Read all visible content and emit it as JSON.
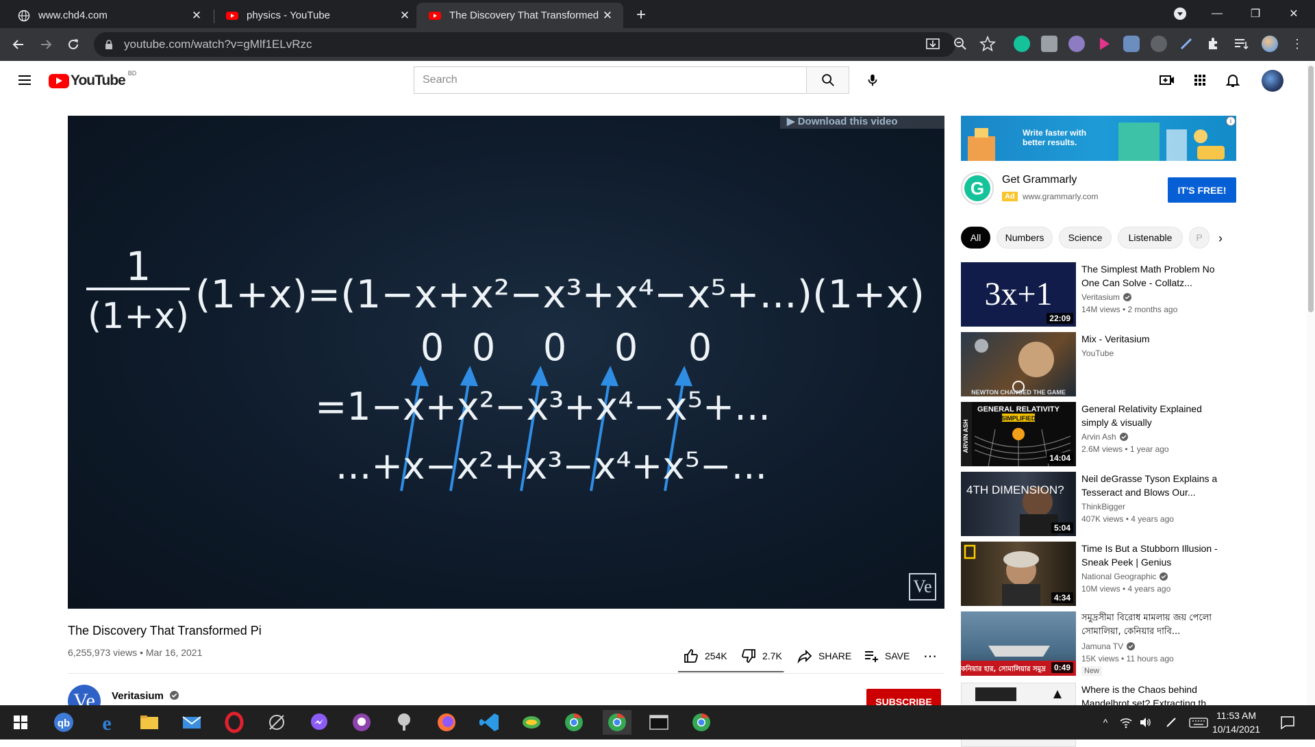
{
  "browser": {
    "tabs": [
      {
        "title": "www.chd4.com",
        "active": false
      },
      {
        "title": "physics - YouTube",
        "active": false
      },
      {
        "title": "The Discovery That Transformed Pi",
        "active": true
      }
    ],
    "url": "youtube.com/watch?v=gMlf1ELvRzc"
  },
  "youtube": {
    "logo_text": "YouTube",
    "country_code": "BD",
    "search_placeholder": "Search"
  },
  "player": {
    "download_banner": "▶ Download this video",
    "watermark": "Ve",
    "equation_line1_rhs": "(1+x)=(1−x+x²−x³+x⁴−x⁵+...)(1+x)",
    "fraction_num": "1",
    "fraction_den": "(1+x)",
    "zeros": [
      "0",
      "0",
      "0",
      "0",
      "0"
    ],
    "line2": "=1−x+x²−x³+x⁴−x⁵+...",
    "line3": "...+x−x²+x³−x⁴+x⁵−..."
  },
  "video": {
    "title": "The Discovery That Transformed Pi",
    "views": "6,255,973 views",
    "date": "Mar 16, 2021",
    "likes": "254K",
    "dislikes": "2.7K",
    "like_ratio": 0.99,
    "share_label": "SHARE",
    "save_label": "SAVE",
    "channel": "Veritasium",
    "channel_initials": "Ve",
    "subscribe_label": "SUBSCRIBE"
  },
  "ad": {
    "banner_text_1": "Write faster with",
    "banner_text_2": "better results.",
    "advertiser": "Get Grammarly",
    "badge": "Ad",
    "url": "www.grammarly.com",
    "cta": "IT'S FREE!",
    "logo_letter": "G"
  },
  "chips": [
    "All",
    "Numbers",
    "Science",
    "Listenable",
    "P"
  ],
  "recommendations": [
    {
      "title": "The Simplest Math Problem No One Can Solve - Collatz...",
      "channel": "Veritasium",
      "verified": true,
      "meta": "14M views • 2 months ago",
      "duration": "22:09",
      "thumb_text": "3x+1"
    },
    {
      "title": "Mix - Veritasium",
      "channel": "YouTube",
      "verified": false,
      "meta": "",
      "duration": "",
      "thumb_text": "NEWTON CHANGED THE GAME"
    },
    {
      "title": "General Relativity Explained simply & visually",
      "channel": "Arvin Ash",
      "verified": true,
      "meta": "2.6M views • 1 year ago",
      "duration": "14:04",
      "thumb_text": "GENERAL RELATIVITY",
      "thumb_sub": "SIMPLIFIED",
      "thumb_side": "ARVIN ASH"
    },
    {
      "title": "Neil deGrasse Tyson Explains a Tesseract and Blows Our...",
      "channel": "ThinkBigger",
      "verified": false,
      "meta": "407K views • 4 years ago",
      "duration": "5:04",
      "thumb_text": "4TH DIMENSION?"
    },
    {
      "title": "Time Is But a Stubborn Illusion - Sneak Peek | Genius",
      "channel": "National Geographic",
      "verified": true,
      "meta": "10M views • 4 years ago",
      "duration": "4:34",
      "thumb_text": ""
    },
    {
      "title": "সমুদ্রসীমা বিরোধ মামলায় জয় পেলো সোমালিয়া, কেনিয়ার দাবি...",
      "channel": "Jamuna TV",
      "verified": true,
      "meta": "15K views • 11 hours ago",
      "duration": "0:49",
      "badge": "New",
      "thumb_text": "কেনিয়ার হার, সোমালিয়ার সমুদ্র"
    },
    {
      "title": "Where is the Chaos behind Mandelbrot set? Extracting th...",
      "channel": "",
      "verified": false,
      "meta": "",
      "duration": "",
      "thumb_text": ""
    }
  ],
  "taskbar": {
    "time": "11:53 AM",
    "date": "10/14/2021"
  }
}
